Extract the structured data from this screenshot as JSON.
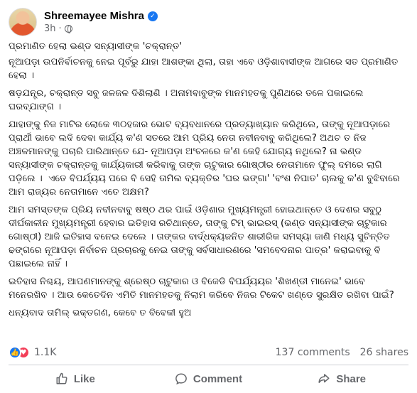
{
  "author": {
    "name": "Shreemayee Mishra",
    "time": "3h",
    "separator": "·",
    "verified_icon": "verified-badge-icon",
    "audience_icon": "globe-icon"
  },
  "post": {
    "lines": [
      "ପ୍ରମାଣିତ ହେଲା ଭଣ୍ଡ ସନ୍ୟାସୀଙ୍କ 'ଚକ୍ରାନ୍ତ'",
      "ନୂଆପଡ଼ା ଉପନିର୍ବାଚନକୁ ନେଇ ପୂର୍ବରୁ ଯାହା ଆଶଙ୍କା ଥିଲା, ତାହା ଏବେ ଓଡ଼ିଶାବାସୀଙ୍କ ଆଗରେ ସତ ପ୍ରମାଣିତ ହେଲା ।",
      "ଷଡ଼ଯନ୍ତ୍ର, ଚକ୍ରାନ୍ତ ସବୁ ଜଳଜଳ ଦିଶିଲାଣି । ଅନାମବାବୁଙ୍କ ମାନମହତକୁ ପୁଣିଥରେ ତଳେ ପକାଇଲେ ଘରବ୍ଯାଙ୍ଗ ।",
      "ଯାହାଙ୍କୁ ନିଜ ମାଟିର ଲୋକେ ୩୦ହଜାର ଭୋଟ ବ୍ୟବଧାନରେ ପ୍ରତ୍ୟାଖ୍ୟାନ କରିଥିଲେ, ତାଙ୍କୁ ନୂଆପଡ଼ାରେ ପ୍ରାର୍ଥୀ ଭାବେ ଲଦି ଦେବା କାର୍ଯ୍ୟ କ'ଣ ସତରେ ଆମ ପ୍ରିୟ ନେତା ନବୀନବାବୁ କରିଥିଲେ? ଅଥଚ ତ ନିଜ ଅଞ୍ଚଳମାନଙ୍କୁ ପଚାରି ପାରିଥାନ୍ତେ ଯେ- ନୂଆପଡ଼ା ଅଂଚଳରେ କ'ଣ କେହି ଯୋଗ୍ୟ ନଥିଲେ? ନା ଭଣ୍ଡ ସନ୍ୟାସୀଙ୍କ ଚକ୍ରାନ୍ତକୁ କାର୍ଯ୍ୟକାରୀ କରିବାକୁ ତାଙ୍କ ଚାଟୁକାର ଗୋଷ୍ଠୀର ନେତାମାନେ ଫୁଲ୍ ଦମରେ ଲାଗି ପଡ଼ିଲେ ।  ଏତେ ବିପର୍ଯ୍ୟୟ ପରେ ବି ସେହି ତାମିଲ ବ୍ୟକ୍ତିର 'ଘର ଭଙ୍ଗା' 'ବଂଶ ନିପାତ' ଚାଲକୁ କ'ଣ ବୁଝିବାରେ ଆମ ରାଜ୍ୟର ନେତାମାନେ ଏତେ ଅକ୍ଷମ?",
      "ଆମ ସମସ୍ତଙ୍କ ପ୍ରିୟ ନବୀନବାବୁ ଷଷ୍ଠ ଥର ପାଇଁ ଓଡ଼ିଶାର ମୁଖ୍ୟମନ୍ତ୍ରୀ ହୋଇଥାନ୍ତେ ଓ ଦେଶର ସବୁଠୁ ଦୀର୍ଘକାଳୀନ ମୁଖ୍ୟମନ୍ତ୍ରୀ ହେବାର ଇତିହାସ ରଚିଥାନ୍ତେ, ତାଙ୍କୁ ଟିମ୍ ଭାଇରସ୍ (ଭଣ୍ଡ ସନ୍ୟାସୀଙ୍କ ଚାଟୁକାର ଗୋଷ୍ଠୀ) ଆଜି ଇତିହାସ ବନେଇ ଦେଲେ । ତାଙ୍କର ବାର୍ଦ୍ଧକ୍ୟଜନିତ ଶାରୀରିକ ସମସ୍ୟା ଜାଣି ମଧ୍ୟ ସୁଚିନ୍ତିତ ଢଙ୍ଗରେ ନୂଆପଡ଼ା ନିର୍ବାଚନ ପ୍ରଚାରକୁ ନେଇ ତାଙ୍କୁ ସର୍ବସାଧାରଣରେ 'ସମବେଦନାର ପାତ୍ର' କରାଇବାକୁ ବି ପଛାଇଲେ ନାହିଁ ।",
      "ଇତିହାସ ନିଶ୍ଚୟ, ଆପଣମାନଙ୍କୁ ଶ୍ରେଷ୍ଠ ଚାଟୁକାର ଓ ବିଜେଡି ବିପର୍ଯ୍ୟୟର 'ଶିଖଣ୍ଡୀ ମାନେଇ' ଭାବେ ମନେରଖିବ । ଆଉ କେତେଦିନ ଏମିତି ମାନମହତକୁ ନିଲାମ କରିବେ ନିଜର ଟିକେଟ ଖଣ୍ଡେ ସୁରକ୍ଷିତ ରଖିବା ପାଇଁ?",
      "ଧନ୍ୟବାଦ ତାମିଲ୍ ଭକ୍ତଗଣ, କେବେ ତ ବିବେକୀ ହୁଅ"
    ]
  },
  "stats": {
    "reactions_count": "1.1K",
    "comments": "137 comments",
    "shares": "26 shares"
  },
  "actions": {
    "like": "Like",
    "comment": "Comment",
    "share": "Share"
  },
  "colors": {
    "accent": "#1877f2",
    "love": "#f33e58",
    "secondary_text": "#65676b"
  }
}
